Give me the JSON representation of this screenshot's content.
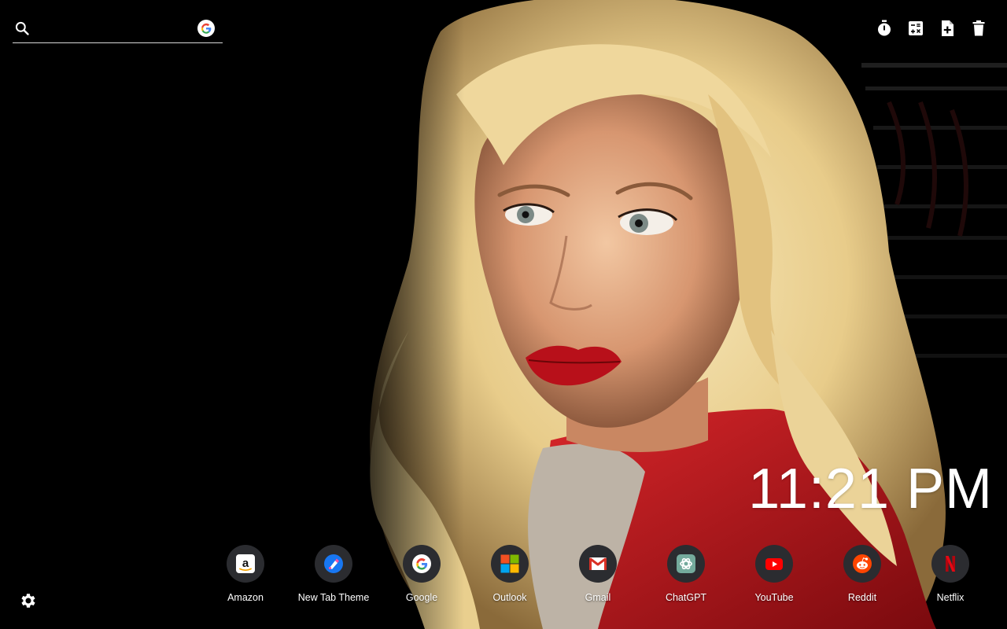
{
  "search": {
    "placeholder": "",
    "value": "",
    "engine_icon": "google-g-icon"
  },
  "toolbar": {
    "items": [
      {
        "icon": "timer-icon"
      },
      {
        "icon": "calculator-icon"
      },
      {
        "icon": "add-note-icon"
      },
      {
        "icon": "trash-icon"
      }
    ]
  },
  "clock": {
    "time": "11:21 PM"
  },
  "shortcuts": [
    {
      "label": "Amazon",
      "icon": "amazon-icon"
    },
    {
      "label": "New Tab Theme",
      "icon": "new-tab-theme-icon"
    },
    {
      "label": "Google",
      "icon": "google-icon"
    },
    {
      "label": "Outlook",
      "icon": "outlook-icon"
    },
    {
      "label": "Gmail",
      "icon": "gmail-icon"
    },
    {
      "label": "ChatGPT",
      "icon": "chatgpt-icon"
    },
    {
      "label": "YouTube",
      "icon": "youtube-icon"
    },
    {
      "label": "Reddit",
      "icon": "reddit-icon"
    },
    {
      "label": "Netflix",
      "icon": "netflix-icon"
    }
  ],
  "settings": {
    "icon": "gear-icon"
  },
  "colors": {
    "background": "#000000",
    "tile": "#2b2c30",
    "text": "#ffffff",
    "hair": "#f0d9a0",
    "jacket": "#c8141a",
    "lips": "#b8101a"
  }
}
